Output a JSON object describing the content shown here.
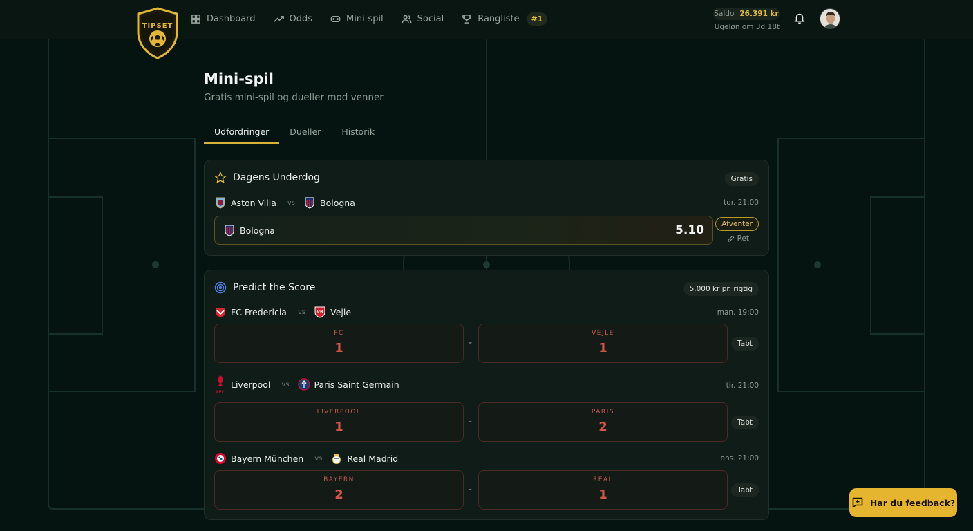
{
  "brand": {
    "logo_text": "TIPSET"
  },
  "nav": {
    "items": [
      {
        "label": "Dashboard",
        "icon": "grid-icon"
      },
      {
        "label": "Odds",
        "icon": "trend-up-icon"
      },
      {
        "label": "Mini-spil",
        "icon": "gamepad-icon"
      },
      {
        "label": "Social",
        "icon": "users-icon"
      },
      {
        "label": "Rangliste",
        "icon": "trophy-icon"
      }
    ],
    "rank_badge": "#1"
  },
  "account": {
    "saldo_label": "Saldo",
    "saldo_value": "26.391 kr",
    "weekly_text": "Ugeløn om 3d 18t"
  },
  "page": {
    "title": "Mini-spil",
    "subtitle": "Gratis mini-spil og dueller mod venner",
    "tabs": [
      "Udfordringer",
      "Dueller",
      "Historik"
    ]
  },
  "underdog": {
    "title": "Dagens Underdog",
    "chip": "Gratis",
    "home": "Aston Villa",
    "vs": "vs",
    "away": "Bologna",
    "kickoff": "tor. 21:00",
    "pick": "Bologna",
    "odds": "5.10",
    "status": "Afventer",
    "edit_label": "Ret"
  },
  "predict": {
    "title": "Predict the Score",
    "chip": "5.000 kr pr. rigtig",
    "matches": [
      {
        "home": "FC Fredericia",
        "vs": "vs",
        "away": "Vejle",
        "kickoff": "man. 19:00",
        "home_short": "FC",
        "away_short": "VEJLE",
        "home_score": "1",
        "away_score": "1",
        "dash": "-",
        "result": "Tabt"
      },
      {
        "home": "Liverpool",
        "vs": "vs",
        "away": "Paris Saint Germain",
        "kickoff": "tir. 21:00",
        "home_short": "LIVERPOOL",
        "away_short": "PARIS",
        "home_score": "1",
        "away_score": "2",
        "dash": "-",
        "result": "Tabt"
      },
      {
        "home": "Bayern München",
        "vs": "vs",
        "away": "Real Madrid",
        "kickoff": "ons. 21:00",
        "home_short": "BAYERN",
        "away_short": "REAL",
        "home_score": "2",
        "away_score": "1",
        "dash": "-",
        "result": "Tabt"
      }
    ]
  },
  "feedback": {
    "label": "Har du feedback?"
  },
  "colors": {
    "accent": "#e6b52f",
    "background": "#051410",
    "card": "#0f1c18",
    "loss": "#d0564a"
  }
}
